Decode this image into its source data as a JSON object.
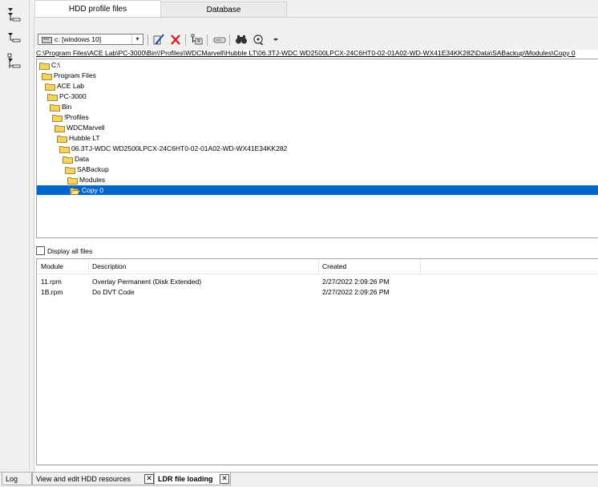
{
  "top_tabs": [
    {
      "label": "HDD profile files",
      "active": true
    },
    {
      "label": "Database",
      "active": false
    }
  ],
  "toolbar": {
    "drive_value": "c: [windows 10]"
  },
  "path": "C:\\Program Files\\ACE Lab\\PC-3000\\Bin\\!Profiles\\WDCMarvell\\Hubble LT\\06.3TJ-WDC WD2500LPCX-24C6HT0-02-01A02-WD-WX41E34KK282\\Data\\SABackup\\Modules\\Copy 0",
  "tree": [
    {
      "label": "C:\\"
    },
    {
      "label": "Program Files"
    },
    {
      "label": "ACE Lab"
    },
    {
      "label": "PC-3000"
    },
    {
      "label": "Bin"
    },
    {
      "label": "!Profiles"
    },
    {
      "label": "WDCMarvell"
    },
    {
      "label": "Hubble LT"
    },
    {
      "label": "06.3TJ-WDC WD2500LPCX-24C6HT0-02-01A02-WD-WX41E34KK282"
    },
    {
      "label": "Data"
    },
    {
      "label": "SABackup"
    },
    {
      "label": "Modules"
    },
    {
      "label": "Copy 0",
      "selected": true
    }
  ],
  "display_all_files": {
    "label": "Display all files",
    "checked": false
  },
  "file_list": {
    "columns": [
      "Module",
      "Description",
      "Created"
    ],
    "rows": [
      {
        "module": "11.rpm",
        "description": "Overlay Permanent (Disk Extended)",
        "created": "2/27/2022 2:09:26 PM"
      },
      {
        "module": "1B.rpm",
        "description": "Do DVT Code",
        "created": "2/27/2022 2:09:26 PM"
      }
    ]
  },
  "bottom_tabs": [
    {
      "label": "Log",
      "active": false
    },
    {
      "label": "View and edit HDD resources",
      "active": false
    },
    {
      "label": "LDR file loading",
      "active": true
    }
  ],
  "colors": {
    "selection": "#0066cc",
    "folder": "#f5d25a",
    "close_red": "#d42020"
  },
  "icons": [
    "expand-all-icon",
    "collapse-icon",
    "tree-view-icon",
    "edit-icon",
    "delete-icon",
    "properties-icon",
    "drive-icon",
    "find-icon",
    "tools-icon",
    "folder-icon",
    "open-folder-icon",
    "close-icon"
  ]
}
